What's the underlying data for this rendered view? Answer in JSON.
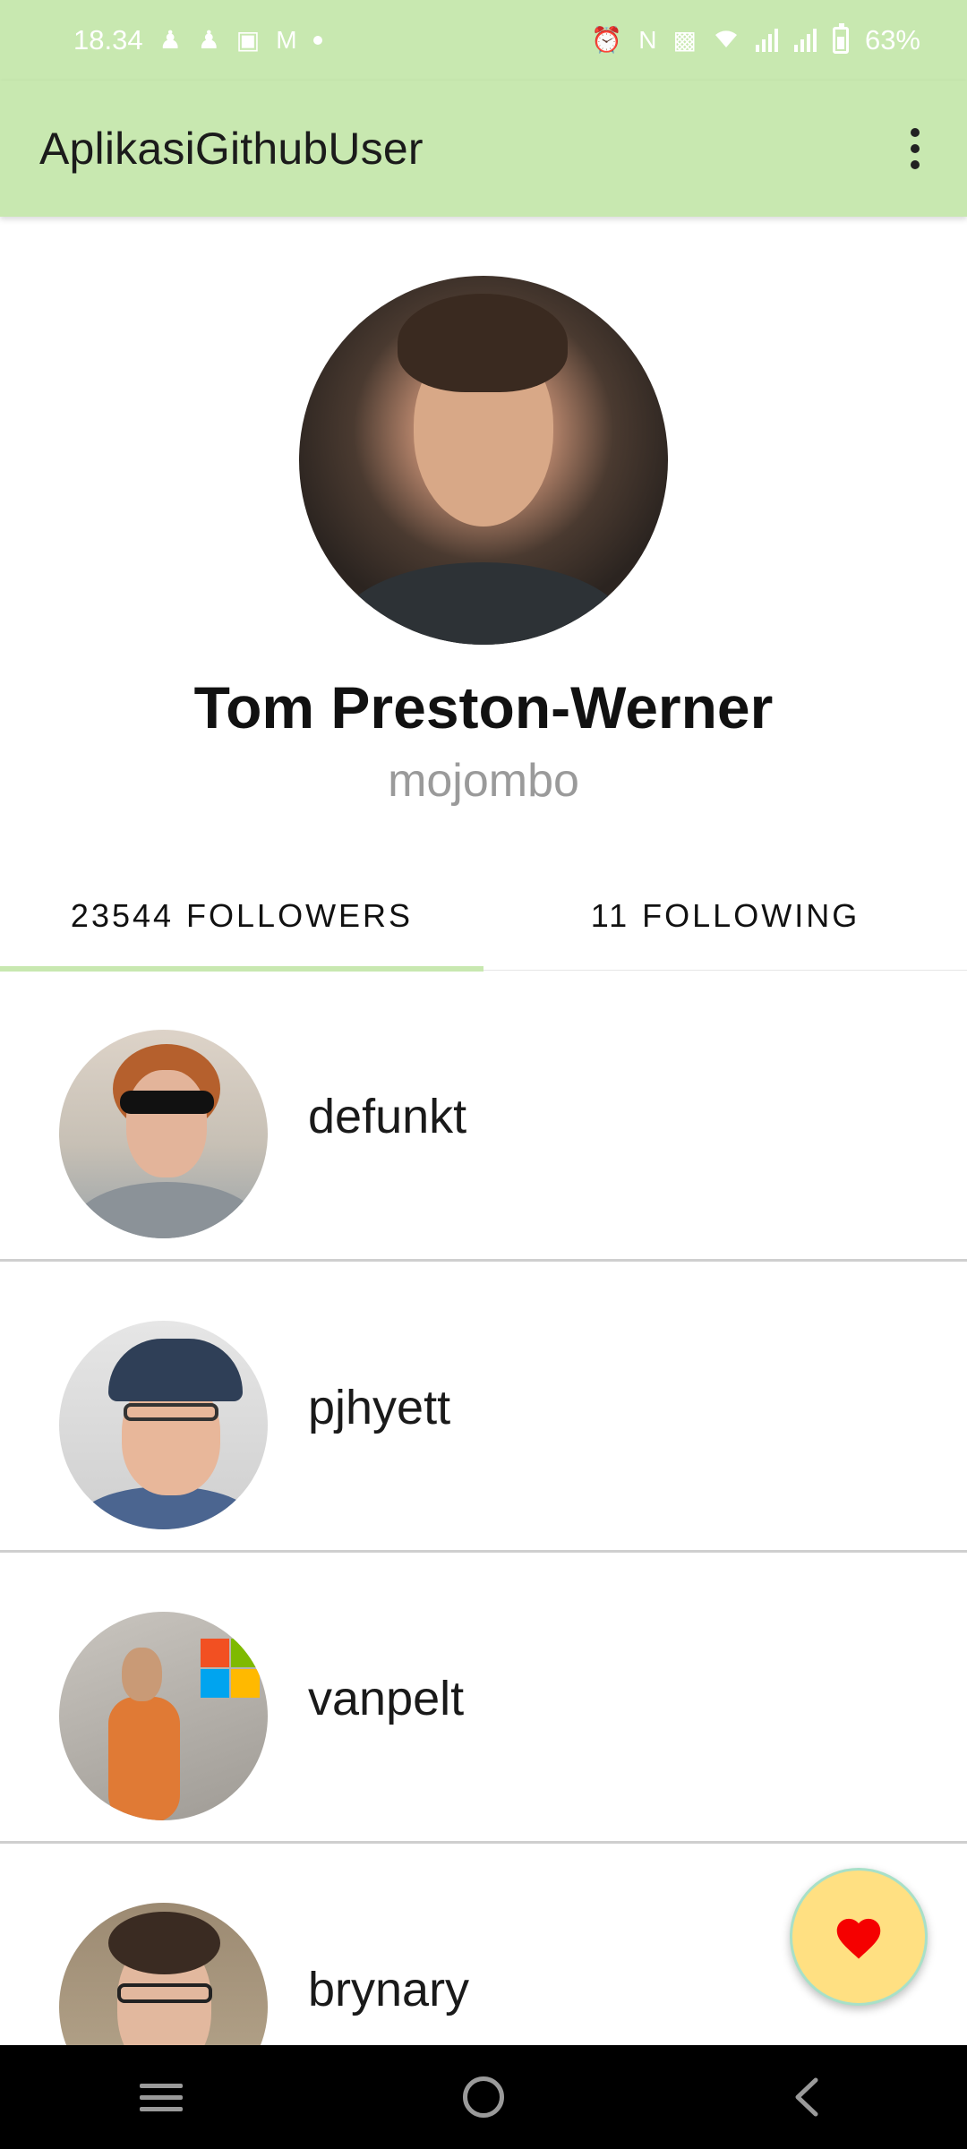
{
  "status_bar": {
    "time": "18.34",
    "battery": "63%",
    "icons": [
      "discord-icon",
      "discord-icon",
      "instagram-icon",
      "gmail-icon",
      "notification-dot",
      "alarm-icon",
      "nfc-icon",
      "vibrate-icon",
      "wifi-icon",
      "signal-icon",
      "signal-icon",
      "battery-icon"
    ]
  },
  "app_bar": {
    "title": "AplikasiGithubUser",
    "menu_icon": "more-vert-icon"
  },
  "profile": {
    "name": "Tom Preston-Werner",
    "login": "mojombo"
  },
  "tabs": [
    {
      "count": "23544",
      "label": "FOLLOWERS",
      "active": true
    },
    {
      "count": "11",
      "label": "FOLLOWING",
      "active": false
    }
  ],
  "followers": [
    {
      "login": "defunkt"
    },
    {
      "login": "pjhyett"
    },
    {
      "login": "vanpelt"
    },
    {
      "login": "brynary"
    }
  ],
  "fab": {
    "icon": "heart-icon",
    "colors": {
      "background": "#ffe082",
      "heart": "#f50000"
    }
  },
  "nav_bar": {
    "icons": [
      "recents-icon",
      "home-icon",
      "back-icon"
    ]
  },
  "colors": {
    "accent": "#c8e8b0",
    "text": "#111111",
    "secondary_text": "#9a9a9a"
  }
}
